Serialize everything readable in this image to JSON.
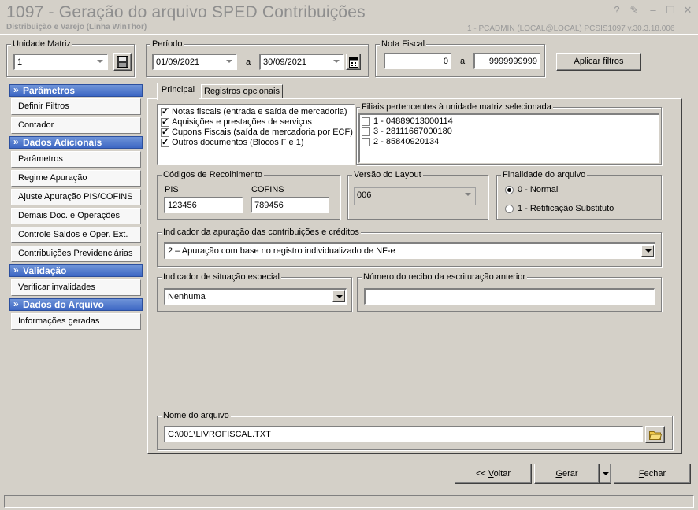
{
  "window": {
    "title": "1097 - Geração do arquivo SPED Contribuições",
    "subtitle": "Distribuição e Varejo (Linha WinThor)",
    "info": "1 - PCADMIN (LOCAL@LOCAL)   PCSIS1097  v.30.3.18.006"
  },
  "unidade": {
    "label": "Unidade Matriz",
    "value": "1"
  },
  "periodo": {
    "label": "Período",
    "from": "01/09/2021",
    "sep": "a",
    "to": "30/09/2021"
  },
  "nota_fiscal": {
    "label": "Nota Fiscal",
    "from": "0",
    "sep": "a",
    "to": "9999999999"
  },
  "apply_filters": "Aplicar filtros",
  "sidebar": [
    {
      "header": "Parâmetros",
      "items": [
        "Definir Filtros",
        "Contador"
      ]
    },
    {
      "header": "Dados Adicionais",
      "items": [
        "Parâmetros",
        "Regime Apuração",
        "Ajuste Apuração PIS/COFINS",
        "Demais Doc. e Operações",
        "Controle Saldos e Oper. Ext.",
        "Contribuições Previdenciárias"
      ]
    },
    {
      "header": "Validação",
      "items": [
        "Verificar invalidades"
      ]
    },
    {
      "header": "Dados do Arquivo",
      "items": [
        "Informações geradas"
      ]
    }
  ],
  "tabs": [
    "Principal",
    "Registros opcionais"
  ],
  "documents": [
    {
      "label": "Notas fiscais (entrada e saída de mercadoria)",
      "checked": true
    },
    {
      "label": "Aquisições e prestações de serviços",
      "checked": true
    },
    {
      "label": "Cupons Fiscais (saída de mercadoria por ECF)",
      "checked": true
    },
    {
      "label": "Outros documentos (Blocos F e 1)",
      "checked": true
    }
  ],
  "filiais": {
    "label": "Filiais pertencentes à unidade matriz selecionada",
    "items": [
      "1 - 04889013000114",
      "3 - 28111667000180",
      "2 - 85840920134"
    ]
  },
  "codigos": {
    "label": "Códigos de Recolhimento",
    "pis_label": "PIS",
    "pis": "123456",
    "cofins_label": "COFINS",
    "cofins": "789456"
  },
  "versao": {
    "label": "Versão do Layout",
    "value": "006"
  },
  "finalidade": {
    "label": "Finalidade do arquivo",
    "options": [
      "0 - Normal",
      "1 - Retificação Substituto"
    ],
    "selected": 0
  },
  "indicador_apuracao": {
    "label": "Indicador da apuração das contribuições e créditos",
    "value": "2 – Apuração com base no registro individualizado de NF-e"
  },
  "indicador_situacao": {
    "label": "Indicador de situação especial",
    "value": "Nenhuma"
  },
  "recibo": {
    "label": "Número do recibo da escrituração anterior",
    "value": ""
  },
  "arquivo": {
    "label": "Nome do arquivo",
    "value": "C:\\001\\LIVROFISCAL.TXT"
  },
  "buttons": {
    "back_prefix": "<< ",
    "back_key": "V",
    "back_rest": "oltar",
    "generate_key": "G",
    "generate_rest": "erar",
    "close_key": "F",
    "close_rest": "echar"
  }
}
